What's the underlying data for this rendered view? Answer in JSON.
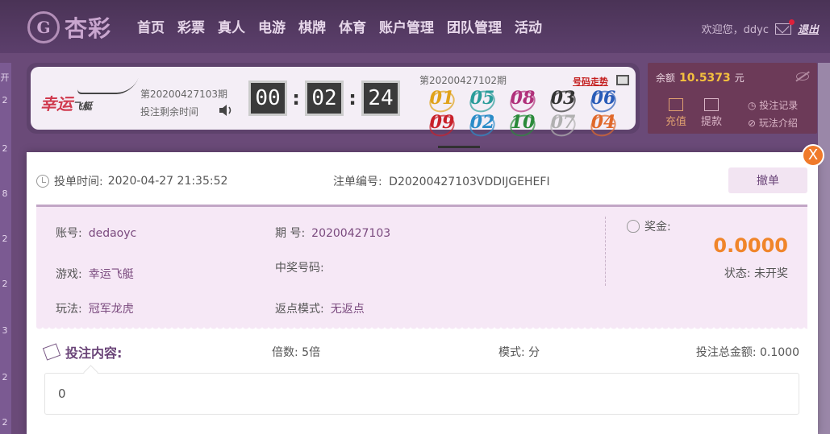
{
  "brand": {
    "logo_mark": "G",
    "logo_text": "杏彩"
  },
  "nav": {
    "items": [
      "首页",
      "彩票",
      "真人",
      "电游",
      "棋牌",
      "体育",
      "账户管理",
      "团队管理",
      "活动"
    ]
  },
  "user": {
    "greeting": "欢迎您，ddyc",
    "logout": "退出"
  },
  "sidebar_numbers": [
    "开",
    "2",
    "2",
    "8",
    "2",
    "2",
    "3",
    "2",
    "2"
  ],
  "lottery": {
    "logo_main": "幸运",
    "logo_sub": "飞艇",
    "current_period": "第20200427103期",
    "countdown_label": "投注剩余时间",
    "countdown": {
      "hh": "00",
      "mm": "02",
      "ss": "24"
    },
    "prev_period": "第20200427102期",
    "trend_link": "号码走势",
    "balls": [
      {
        "n": "01",
        "color": "#e0a21a"
      },
      {
        "n": "05",
        "color": "#2a9c9a"
      },
      {
        "n": "08",
        "color": "#b0307a"
      },
      {
        "n": "03",
        "color": "#333333"
      },
      {
        "n": "06",
        "color": "#2a5cb8"
      },
      {
        "n": "09",
        "color": "#c8202a"
      },
      {
        "n": "02",
        "color": "#2a8cc8"
      },
      {
        "n": "10",
        "color": "#2a8a3a"
      },
      {
        "n": "07",
        "color": "#b0b0b0"
      },
      {
        "n": "04",
        "color": "#e0682a"
      }
    ]
  },
  "balance": {
    "label": "余额",
    "amount": "10.5373",
    "unit": "元",
    "recharge": "充值",
    "withdraw": "提款",
    "bet_record": "投注记录",
    "play_intro": "玩法介绍"
  },
  "modal": {
    "close": "X",
    "time_label": "投单时间:",
    "time_value": "2020-04-27 21:35:52",
    "order_label": "注单编号:",
    "order_value": "D20200427103VDDIJGEHEFI",
    "cancel": "撤单",
    "account_label": "账号:",
    "account_value": "dedaoyc",
    "period_label": "期 号:",
    "period_value": "20200427103",
    "game_label": "游戏:",
    "game_value": "幸运飞艇",
    "win_numbers_label": "中奖号码:",
    "play_label": "玩法:",
    "play_value": "冠军龙虎",
    "rebate_label": "返点模式:",
    "rebate_value": "无返点",
    "prize_label": "奖金:",
    "prize_amount": "0.0000",
    "status": "状态: 未开奖",
    "bet_content_label": "投注内容:",
    "multiplier": "倍数: 5倍",
    "mode": "模式: 分",
    "total": "投注总金额: 0.1000",
    "content_value": "0"
  },
  "colors": {
    "accent": "#6a4478",
    "prize": "#f0852a",
    "balance_amount": "#f4c03e",
    "close": "#f07a2a"
  }
}
